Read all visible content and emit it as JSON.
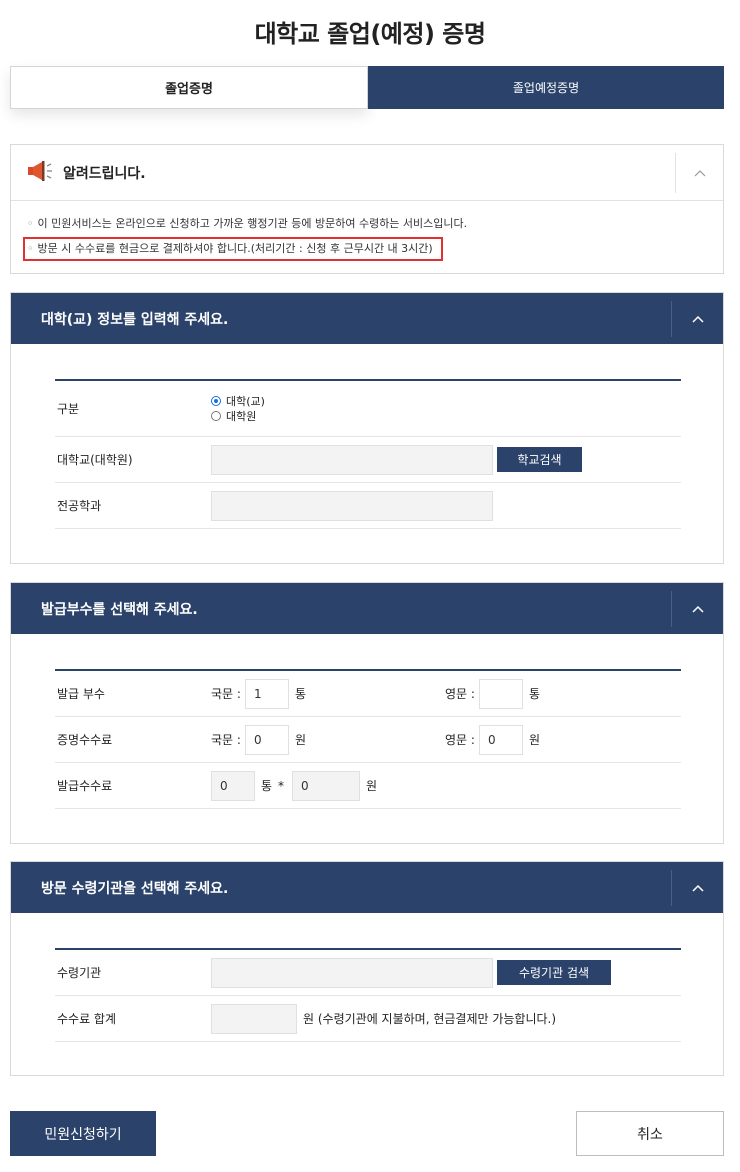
{
  "page": {
    "title": "대학교 졸업(예정) 증명"
  },
  "tabs": [
    {
      "label": "졸업증명",
      "active": true
    },
    {
      "label": "졸업예정증명",
      "active": false
    }
  ],
  "notice": {
    "title": "알려드립니다.",
    "icon": "megaphone-icon",
    "toggle": "^",
    "lines": [
      "이 민원서비스는 온라인으로 신청하고 가까운 행정기관 등에 방문하여 수령하는 서비스입니다.",
      "방문 시 수수료를 현금으로 결제하셔야 합니다.(처리기간 : 신청 후 근무시간 내 3시간)"
    ]
  },
  "university_section": {
    "title": "대학(교) 정보를 입력해 주세요.",
    "toggle": "^",
    "type_label": "구분",
    "type_options": [
      "대학(교)",
      "대학원"
    ],
    "type_selected": "대학(교)",
    "school_label": "대학교(대학원)",
    "school_value": "",
    "school_search_button": "학교검색",
    "major_label": "전공학과",
    "major_value": ""
  },
  "copies_section": {
    "title": "발급부수를 선택해 주세요.",
    "toggle": "^",
    "copies_label": "발급 부수",
    "korean_label": "국문 :",
    "korean_copies": "1",
    "copies_unit": "통",
    "english_label": "영문 :",
    "english_copies": "",
    "cert_fee_label": "증명수수료",
    "korean_fee": "0",
    "english_fee": "0",
    "won_unit": "원",
    "issue_fee_label": "발급수수료",
    "issue_count": "0",
    "issue_fee": "0",
    "multiply": "*"
  },
  "pickup_section": {
    "title": "방문 수령기관을 선택해 주세요.",
    "toggle": "^",
    "agency_label": "수령기관",
    "agency_value": "",
    "agency_search_button": "수령기관 검색",
    "total_label": "수수료 합계",
    "total_value": "",
    "total_note": "원 (수령기관에 지불하며, 현금결제만 가능합니다.)"
  },
  "actions": {
    "submit": "민원신청하기",
    "cancel": "취소"
  },
  "colors": {
    "primary": "#2b426b",
    "highlight": "#e03030"
  }
}
